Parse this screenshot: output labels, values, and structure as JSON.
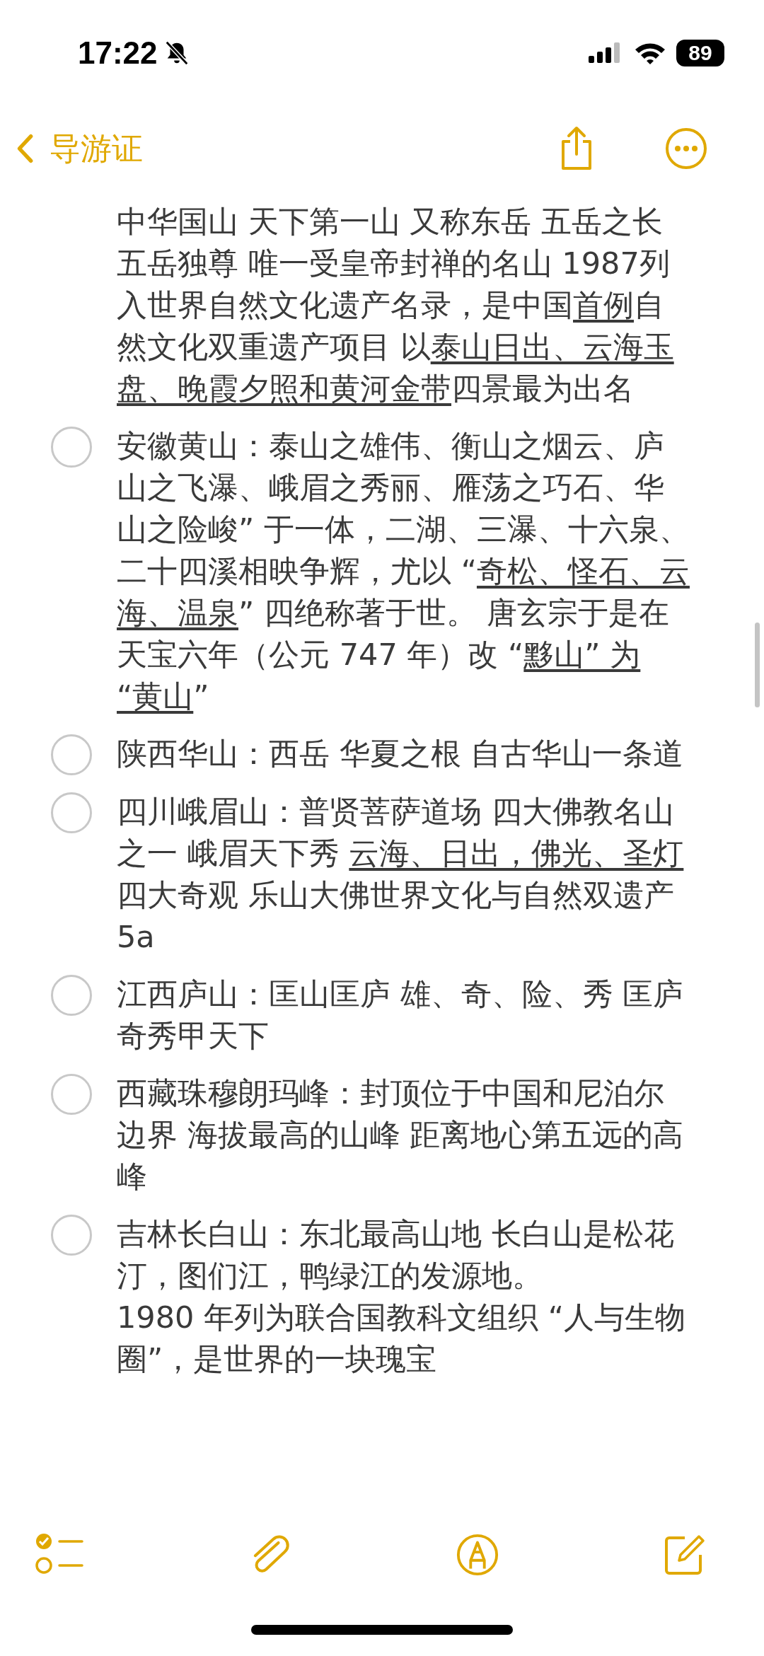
{
  "status_bar": {
    "time": "17:22",
    "battery": "89"
  },
  "nav": {
    "back_label": "导游证"
  },
  "items": [
    {
      "kind": "partial",
      "segments": [
        {
          "text": "中华国山 天下第一山 又称东岳 五岳之长五岳独尊 唯一受皇帝封禅的名山 1987列入世界自然文化遗产名录，是中国",
          "underlined": false
        },
        {
          "text": "首例",
          "underlined": true
        },
        {
          "text": "自然文化双重遗产项目 以",
          "underlined": false
        },
        {
          "text": "泰山日出、云海玉盘、晚霞夕照和黄河金带",
          "underlined": true
        },
        {
          "text": "四景最为出名",
          "underlined": false
        }
      ]
    },
    {
      "kind": "task",
      "checked": false,
      "segments": [
        {
          "text": "安徽黄山：泰山之雄伟、衡山之烟云、庐山之飞瀑、峨眉之秀丽、雁荡之巧石、华山之险峻” 于一体，二湖、三瀑、十六泉、二十四溪相映争辉，尤以 “",
          "underlined": false
        },
        {
          "text": "奇松、怪石、云海、温泉",
          "underlined": true
        },
        {
          "text": "” 四绝称著于世。 唐玄宗于是在天宝六年（公元 747 年）改 “",
          "underlined": false
        },
        {
          "text": "黟山” 为 “黄山",
          "underlined": true
        },
        {
          "text": "”",
          "underlined": false
        }
      ]
    },
    {
      "kind": "task",
      "checked": false,
      "segments": [
        {
          "text": "陕西华山：西岳 华夏之根 自古华山一条道",
          "underlined": false
        }
      ]
    },
    {
      "kind": "task",
      "checked": false,
      "segments": [
        {
          "text": "四川峨眉山：普贤菩萨道场 四大佛教名山之一  峨眉天下秀  ",
          "underlined": false
        },
        {
          "text": "云海、日出，佛光、圣灯",
          "underlined": true
        },
        {
          "text": "四大奇观 乐山大佛世界文化与自然双遗产 5a",
          "underlined": false
        }
      ]
    },
    {
      "kind": "task",
      "checked": false,
      "segments": [
        {
          "text": "江西庐山：匡山匡庐 雄、奇、险、秀  匡庐奇秀甲天下",
          "underlined": false
        }
      ]
    },
    {
      "kind": "task",
      "checked": false,
      "segments": [
        {
          "text": "西藏珠穆朗玛峰：封顶位于中国和尼泊尔边界 海拔最高的山峰  距离地心第五远的高峰",
          "underlined": false
        }
      ]
    },
    {
      "kind": "task",
      "checked": false,
      "segments": [
        {
          "text": "吉林长白山：东北最高山地 长白山是松花汀，图们江，鸭绿江的发源地。\n1980 年列为联合国教科文组织 “人与生物圈”，是世界的一块瑰宝",
          "underlined": false
        }
      ]
    }
  ]
}
